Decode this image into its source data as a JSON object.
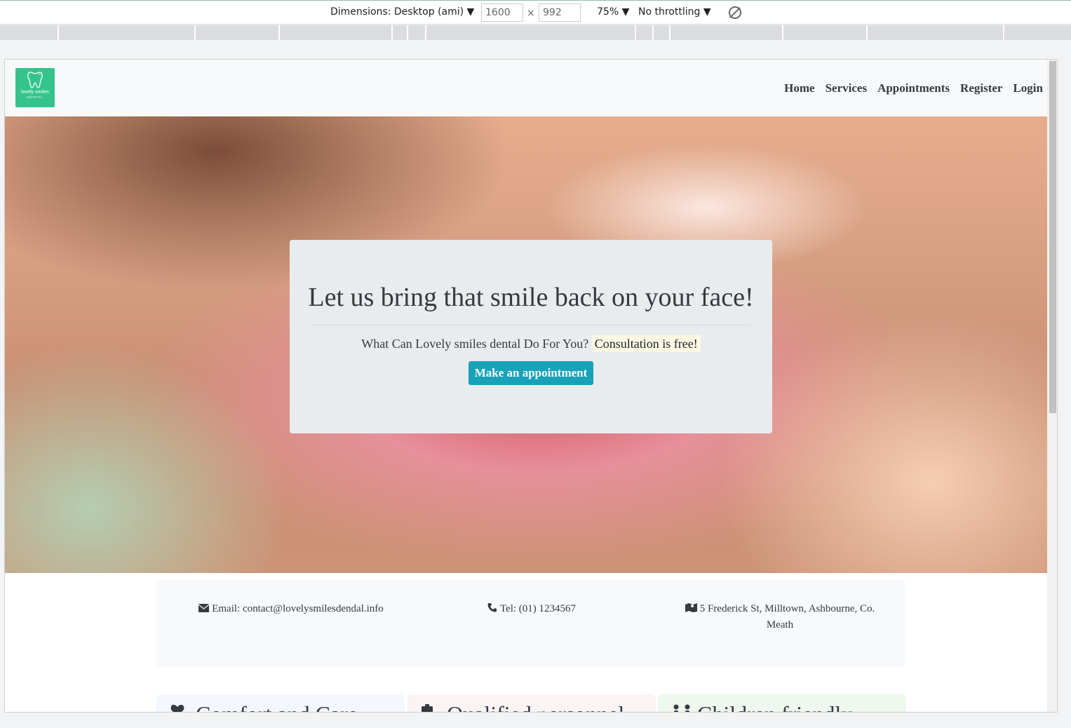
{
  "devtools": {
    "dimensions_label": "Dimensions: Desktop (ami) ▼",
    "width_value": "1600",
    "times_sign": "×",
    "height_value": "992",
    "zoom": "75% ▼",
    "throttling": "No throttling ▼"
  },
  "navbar": {
    "logo_name": "lovely smiles",
    "logo_sub": "DENTAL",
    "links": [
      "Home",
      "Services",
      "Appointments",
      "Register",
      "Login"
    ]
  },
  "hero": {
    "heading": "Let us bring that smile back on your face!",
    "lead": "What Can Lovely smiles dental Do For You?",
    "highlight": "Consultation is free!",
    "button": "Make an appointment"
  },
  "contact": {
    "email": "Email: contact@lovelysmilesdendal.info",
    "tel": "Tel: (01) 1234567",
    "address": "5 Frederick St, Milltown, Ashbourne, Co. Meath"
  },
  "features": [
    {
      "title": "Comfort and Care",
      "icon": "heart-icon",
      "bg": "#f4f8fc"
    },
    {
      "title": "Qualified personnel",
      "icon": "clipboard-icon",
      "bg": "#fcf3f3"
    },
    {
      "title": "Children friendly",
      "icon": "child-icon",
      "bg": "#eef8ee"
    }
  ],
  "colors": {
    "brand": "#33c48c",
    "button": "#17a2b8",
    "text": "#343a40",
    "highlight": "#fcf8e3"
  }
}
